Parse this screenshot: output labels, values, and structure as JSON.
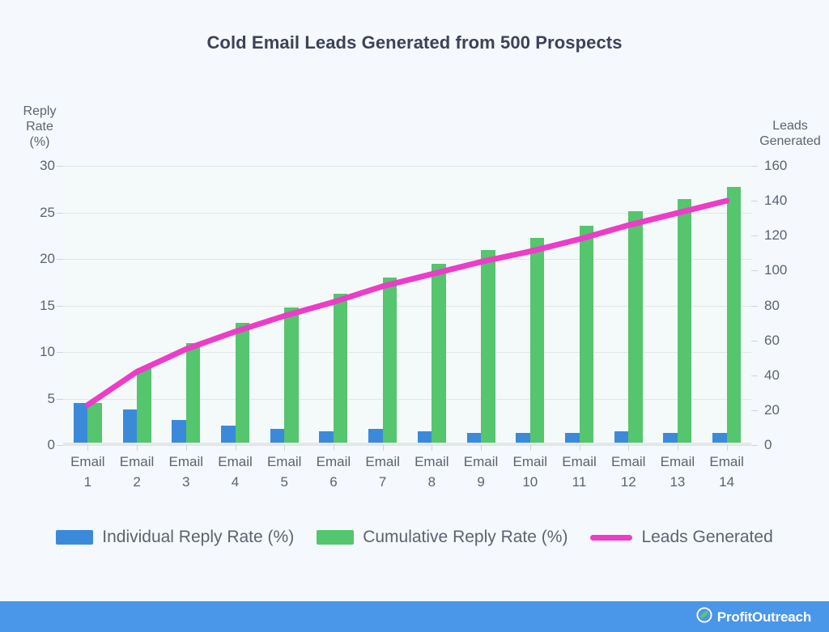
{
  "chart_data": {
    "type": "bar",
    "title": "Cold Email Leads Generated from 500 Prospects",
    "xlabel": "",
    "ylabel": "Reply Rate (%)",
    "y2label": "Leads Generated",
    "categories": [
      "Email\n1",
      "Email\n2",
      "Email\n3",
      "Email\n4",
      "Email\n5",
      "Email\n6",
      "Email\n7",
      "Email\n8",
      "Email\n9",
      "Email\n10",
      "Email\n11",
      "Email\n12",
      "Email\n13",
      "Email\n14"
    ],
    "series": [
      {
        "name": "Individual Reply Rate (%)",
        "type": "bar",
        "axis": "left",
        "color": "#3b8ada",
        "values": [
          4.5,
          3.8,
          2.7,
          2.1,
          1.7,
          1.5,
          1.7,
          1.5,
          1.3,
          1.3,
          1.3,
          1.5,
          1.3,
          1.3
        ]
      },
      {
        "name": "Cumulative Reply Rate (%)",
        "type": "bar",
        "axis": "left",
        "color": "#55c56e",
        "values": [
          4.5,
          8.3,
          11.0,
          13.1,
          14.8,
          16.3,
          18.0,
          19.5,
          21.0,
          22.3,
          23.6,
          25.1,
          26.4,
          27.7
        ]
      },
      {
        "name": "Leads Generated",
        "type": "line",
        "axis": "right",
        "color": "#ec3cc8",
        "values": [
          23,
          42,
          55,
          65,
          74,
          82,
          91,
          98,
          105,
          111,
          118,
          126,
          133,
          140
        ]
      }
    ],
    "y_axis_left": {
      "label": "Reply\nRate\n(%)",
      "ticks": [
        0,
        5,
        10,
        15,
        20,
        25,
        30
      ],
      "min": 0,
      "max": 30
    },
    "y_axis_right": {
      "label": "Leads\nGenerated",
      "ticks": [
        0,
        20,
        40,
        60,
        80,
        100,
        120,
        140,
        160
      ],
      "min": 0,
      "max": 160
    },
    "grid": true,
    "legend_position": "bottom"
  },
  "legend": {
    "items": [
      {
        "label": "Individual Reply Rate (%)",
        "color": "#3b8ada",
        "marker": "square"
      },
      {
        "label": "Cumulative Reply Rate (%)",
        "color": "#55c56e",
        "marker": "square"
      },
      {
        "label": "Leads Generated",
        "color": "#ec3cc8",
        "marker": "line"
      }
    ]
  },
  "footer": {
    "brand": "ProfitOutreach",
    "background": "#4a96e8"
  }
}
